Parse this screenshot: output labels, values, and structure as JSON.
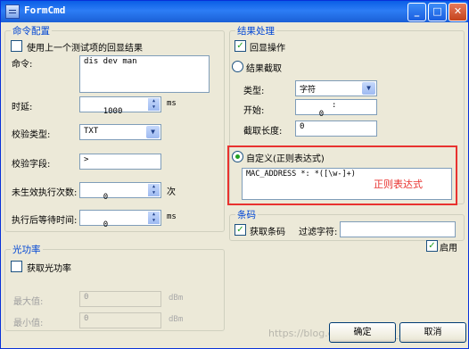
{
  "window": {
    "title": "FormCmd",
    "min": "_",
    "max": "□",
    "close": "✕"
  },
  "cmd_group": {
    "title": "命令配置",
    "use_prev_label": "使用上一个测试项的回显结果",
    "cmd_label": "命令:",
    "cmd_value": "dis dev man",
    "delay_label": "时延:",
    "delay_value": "1000",
    "delay_unit": "ms",
    "check_type_label": "校验类型:",
    "check_type_value": "TXT",
    "check_field_label": "校验字段:",
    "check_field_value": ">",
    "retry_label": "未生效执行次数:",
    "retry_value": "0",
    "retry_unit": "次",
    "wait_label": "执行后等待时间:",
    "wait_value": "0",
    "wait_unit": "ms"
  },
  "result_group": {
    "title": "结果处理",
    "echo_label": "回显操作",
    "capture_label": "结果截取",
    "type_label": "类型:",
    "type_value": "字符",
    "start_label": "开始:",
    "start_value": "0",
    "start_sep": ":",
    "length_label": "截取长度:",
    "length_value": "0",
    "custom_label": "自定义(正则表达式)",
    "regex_value": "MAC_ADDRESS *: *([\\w-]+)",
    "annotation": "正则表达式"
  },
  "barcode_group": {
    "title": "条码",
    "get_barcode_label": "获取条码",
    "filter_label": "过滤字符:",
    "filter_value": ""
  },
  "enable_label": "启用",
  "optical_group": {
    "title": "光功率",
    "get_power_label": "获取光功率",
    "max_label": "最大值:",
    "max_value": "0",
    "max_unit": "dBm",
    "min_label": "最小值:",
    "min_value": "0",
    "min_unit": "dBm"
  },
  "buttons": {
    "ok": "确定",
    "cancel": "取消"
  },
  "watermark": "https://blog.csdn.net/XXX_XXXX"
}
